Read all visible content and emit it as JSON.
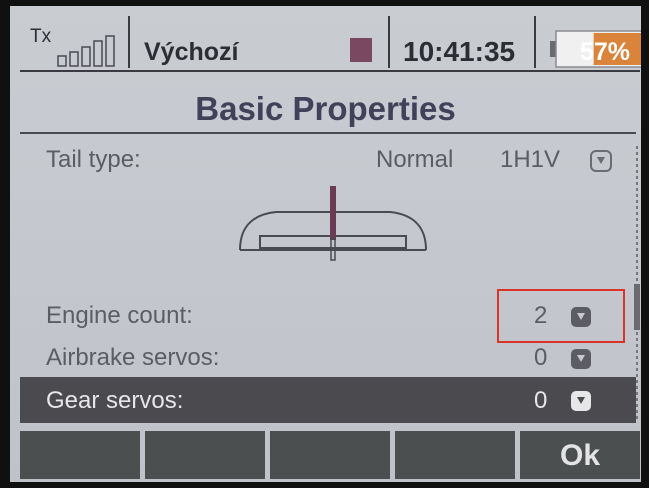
{
  "status_bar": {
    "tx_label": "Tx",
    "model_name": "Výchozí",
    "time": "10:41:35",
    "battery_percent": "57%",
    "battery_level": 0.57,
    "signal_bars": 0,
    "record_color": "#7b4862"
  },
  "title": "Basic Properties",
  "tail_type": {
    "label": "Tail type:",
    "value": "Normal",
    "code": "1H1V",
    "icon": "dropdown-arrow-icon"
  },
  "engine_count": {
    "label": "Engine count:",
    "value": "2",
    "icon": "dropdown-arrow-icon"
  },
  "airbrake_servos": {
    "label": "Airbrake servos:",
    "value": "0",
    "icon": "dropdown-arrow-icon"
  },
  "gear_servos": {
    "label": "Gear servos:",
    "value": "0",
    "icon": "dropdown-arrow-icon",
    "selected": true
  },
  "function_keys": [
    "",
    "",
    "",
    "",
    "Ok"
  ],
  "colors": {
    "screen_bg": "#c6cacf",
    "text": "#5b5d63",
    "selected_row_bg": "#4a4a4f",
    "highlight_border": "#d8342a",
    "battery_fill": "#d9843a"
  }
}
